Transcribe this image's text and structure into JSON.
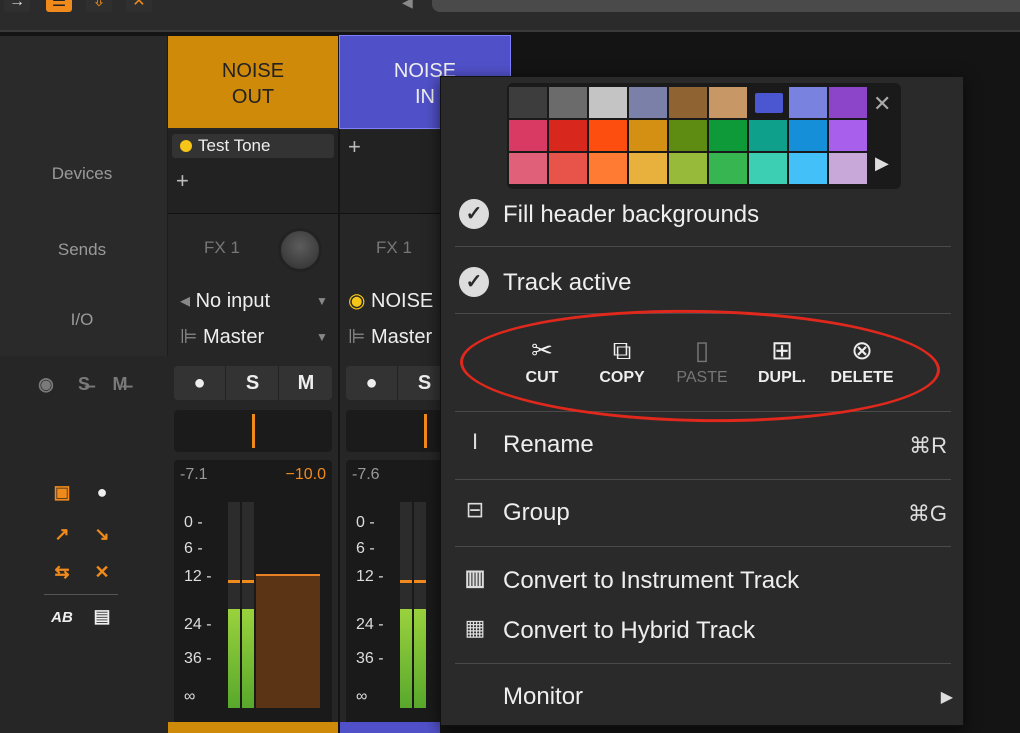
{
  "topbar": {
    "icons": [
      "arrow-right-icon",
      "list-icon",
      "download-icon",
      "close-icon"
    ]
  },
  "sidepanel": {
    "labels": [
      "Devices",
      "Sends",
      "I/O"
    ],
    "mute_solo_icons": [
      "mute-all-icon",
      "solo-all-icon",
      "mute-icon"
    ]
  },
  "tracks": [
    {
      "title_line1": "NOISE",
      "title_line2": "OUT",
      "color": "#d08a0a",
      "device": "Test Tone",
      "fx_label": "FX 1",
      "input": "No input",
      "output": "Master",
      "buttons": [
        "●",
        "S",
        "M"
      ],
      "peak_left": "-7.1",
      "peak_right": "−10.0",
      "scale": [
        "0 -",
        "6 -",
        "12 -",
        "24 -",
        "36 -",
        "∞"
      ],
      "meter_levels": [
        0.48,
        0.48
      ],
      "fader_level": 0.65
    },
    {
      "title_line1": "NOISE",
      "title_line2": "IN",
      "color": "#5050c8",
      "device": "",
      "fx_label": "FX 1",
      "input": "NOISE",
      "output": "Master",
      "buttons": [
        "●",
        "S"
      ],
      "peak_left": "-7.6",
      "peak_right": "",
      "scale": [
        "0 -",
        "6 -",
        "12 -",
        "24 -",
        "36 -",
        "∞"
      ],
      "meter_levels": [
        0.48,
        0.48
      ]
    }
  ],
  "menu": {
    "palette": [
      "#3d3d3d",
      "#6b6b6b",
      "#c4c4c4",
      "#7a80a8",
      "#8f6432",
      "#c79766",
      "#4a57d0",
      "#7a82e0",
      "#8c45c8",
      "#d83a64",
      "#d8281e",
      "#fd4d0f",
      "#d49012",
      "#5e8b12",
      "#0f9a3a",
      "#0fa08c",
      "#1590d8",
      "#a860ec",
      "#e0607a",
      "#e8544a",
      "#ff7b33",
      "#e8b03c",
      "#98ba3a",
      "#36b550",
      "#3ccfb4",
      "#44c0f8",
      "#c8a8d8"
    ],
    "fill_header": "Fill header backgrounds",
    "track_active": "Track active",
    "actions": [
      {
        "label": "CUT",
        "icon": "✂",
        "enabled": true
      },
      {
        "label": "COPY",
        "icon": "⧉",
        "enabled": true
      },
      {
        "label": "PASTE",
        "icon": "▯",
        "enabled": false
      },
      {
        "label": "DUPL.",
        "icon": "⊞",
        "enabled": true
      },
      {
        "label": "DELETE",
        "icon": "⊗",
        "enabled": true
      }
    ],
    "rename": "Rename",
    "rename_shortcut": "⌘R",
    "group": "Group",
    "group_shortcut": "⌘G",
    "convert_instrument": "Convert to Instrument Track",
    "convert_hybrid": "Convert to Hybrid Track",
    "monitor": "Monitor"
  }
}
